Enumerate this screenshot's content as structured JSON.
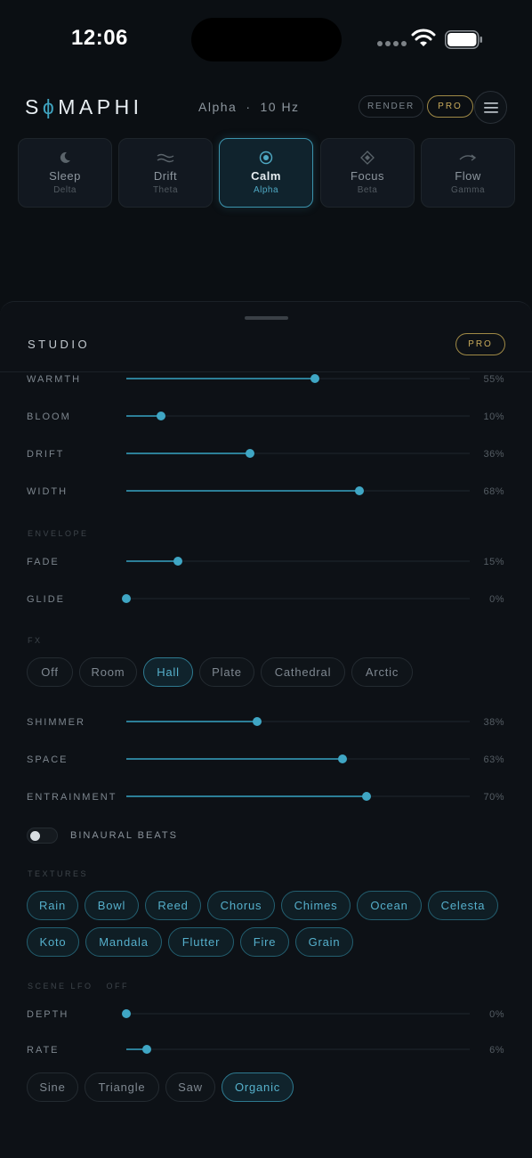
{
  "status": {
    "time": "12:06"
  },
  "header": {
    "logo_left": "S",
    "logo_phi": "ϕ",
    "logo_right": "MAPHI",
    "wave": "Alpha",
    "separator": "·",
    "frequency": "10 Hz",
    "render_label": "RENDER",
    "pro_label": "PRO"
  },
  "modes": [
    {
      "name": "Sleep",
      "band": "Delta",
      "icon": "moon-icon"
    },
    {
      "name": "Drift",
      "band": "Theta",
      "icon": "waves-icon"
    },
    {
      "name": "Calm",
      "band": "Alpha",
      "icon": "target-icon",
      "active": true
    },
    {
      "name": "Focus",
      "band": "Beta",
      "icon": "diamond-icon"
    },
    {
      "name": "Flow",
      "band": "Gamma",
      "icon": "curved-arrow-icon"
    }
  ],
  "studio": {
    "title": "STUDIO",
    "pro_label": "PRO"
  },
  "tone": [
    {
      "label": "WARMTH",
      "value": "55%",
      "level": 0.55
    },
    {
      "label": "BLOOM",
      "value": "10%",
      "level": 0.1
    },
    {
      "label": "DRIFT",
      "value": "36%",
      "level": 0.36
    },
    {
      "label": "WIDTH",
      "value": "68%",
      "level": 0.68
    }
  ],
  "envelope": {
    "title": "ENVELOPE",
    "sliders": [
      {
        "label": "FADE",
        "value": "15%",
        "level": 0.15
      },
      {
        "label": "GLIDE",
        "value": "0%",
        "level": 0.0
      }
    ]
  },
  "fx": {
    "title": "FX",
    "options": [
      "Off",
      "Room",
      "Hall",
      "Plate",
      "Cathedral",
      "Arctic"
    ],
    "selected": "Hall",
    "sliders": [
      {
        "label": "SHIMMER",
        "value": "38%",
        "level": 0.38
      },
      {
        "label": "SPACE",
        "value": "63%",
        "level": 0.63
      },
      {
        "label": "ENTRAINMENT",
        "value": "70%",
        "level": 0.7
      }
    ]
  },
  "binaural": {
    "label": "BINAURAL BEATS",
    "on": false
  },
  "textures": {
    "title": "TEXTURES",
    "items": [
      "Rain",
      "Bowl",
      "Reed",
      "Chorus",
      "Chimes",
      "Ocean",
      "Celesta",
      "Koto",
      "Mandala",
      "Flutter",
      "Fire",
      "Grain"
    ]
  },
  "lfo": {
    "title": "SCENE LFO",
    "state": "OFF",
    "sliders": [
      {
        "label": "DEPTH",
        "value": "0%",
        "level": 0.0
      },
      {
        "label": "RATE",
        "value": "6%",
        "level": 0.06
      }
    ],
    "shapes": [
      "Sine",
      "Triangle",
      "Saw",
      "Organic"
    ],
    "selected": "Organic"
  },
  "colors": {
    "accent": "#3fa6c4",
    "pro_gold": "#c9ab5b",
    "background": "#0b0f13"
  }
}
